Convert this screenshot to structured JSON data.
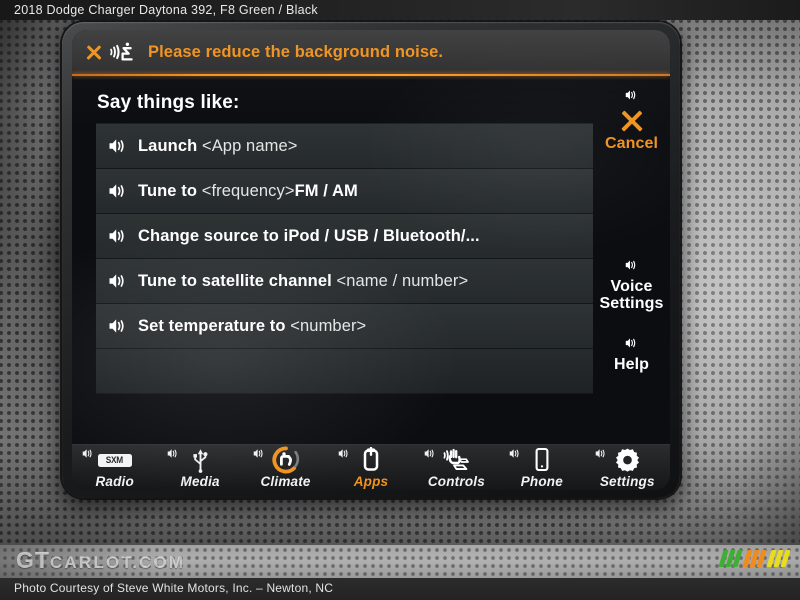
{
  "caption": {
    "title": "2018 Dodge Charger Daytona 392,  F8 Green / Black"
  },
  "colors": {
    "accent_orange": "#f0921e",
    "screen_bg": "#0b0d11",
    "row_bg": "#707c78",
    "text_white": "#ffffff"
  },
  "screen": {
    "warning": {
      "close_icon": "close-x-icon",
      "noise_icon": "voice-noise-icon",
      "message": "Please reduce the background noise."
    },
    "heading": "Say things like:",
    "commands": [
      {
        "icon": "speaker-icon",
        "command": "Launch",
        "placeholder": "<App name>",
        "suffix": ""
      },
      {
        "icon": "speaker-icon",
        "command": "Tune to",
        "placeholder": "<frequency>",
        "suffix": "FM / AM"
      },
      {
        "icon": "speaker-icon",
        "command": "Change source to iPod / USB / Bluetooth/...",
        "placeholder": "",
        "suffix": ""
      },
      {
        "icon": "speaker-icon",
        "command": "Tune to satellite channel",
        "placeholder": "<name / number>",
        "suffix": ""
      },
      {
        "icon": "speaker-icon",
        "command": "Set temperature to",
        "placeholder": "<number>",
        "suffix": ""
      },
      {
        "icon": "",
        "command": "",
        "placeholder": "",
        "suffix": ""
      }
    ],
    "rail": [
      {
        "id": "cancel",
        "icon": "speaker-icon",
        "glyph": "close-x-icon",
        "label": "Cancel",
        "accent": true
      },
      {
        "id": "voice-settings",
        "icon": "speaker-icon",
        "label": "Voice\nSettings",
        "label_line1": "Voice",
        "label_line2": "Settings",
        "accent": false
      },
      {
        "id": "help",
        "icon": "speaker-icon",
        "label": "Help",
        "accent": false
      }
    ],
    "nav": [
      {
        "id": "radio",
        "icon": "sxm-logo-icon",
        "label": "Radio",
        "active": false
      },
      {
        "id": "media",
        "icon": "usb-icon",
        "label": "Media",
        "active": false
      },
      {
        "id": "climate",
        "icon": "climate-seat-icon",
        "label": "Climate",
        "active": false
      },
      {
        "id": "apps",
        "icon": "apps-icon",
        "label": "Apps",
        "active": true
      },
      {
        "id": "controls",
        "icon": "controls-hand-icon",
        "label": "Controls",
        "active": false
      },
      {
        "id": "phone",
        "icon": "phone-icon",
        "label": "Phone",
        "active": false
      },
      {
        "id": "settings",
        "icon": "gear-icon",
        "label": "Settings",
        "active": false
      }
    ]
  },
  "footer": {
    "watermark_main": "GT",
    "watermark_rest": "CARLOT.COM",
    "courtesy": "Photo Courtesy of Steve White Motors, Inc. – Newton, NC",
    "logo_colors": [
      "#3fae34",
      "#ef8c1d",
      "#e8dc1c"
    ]
  }
}
